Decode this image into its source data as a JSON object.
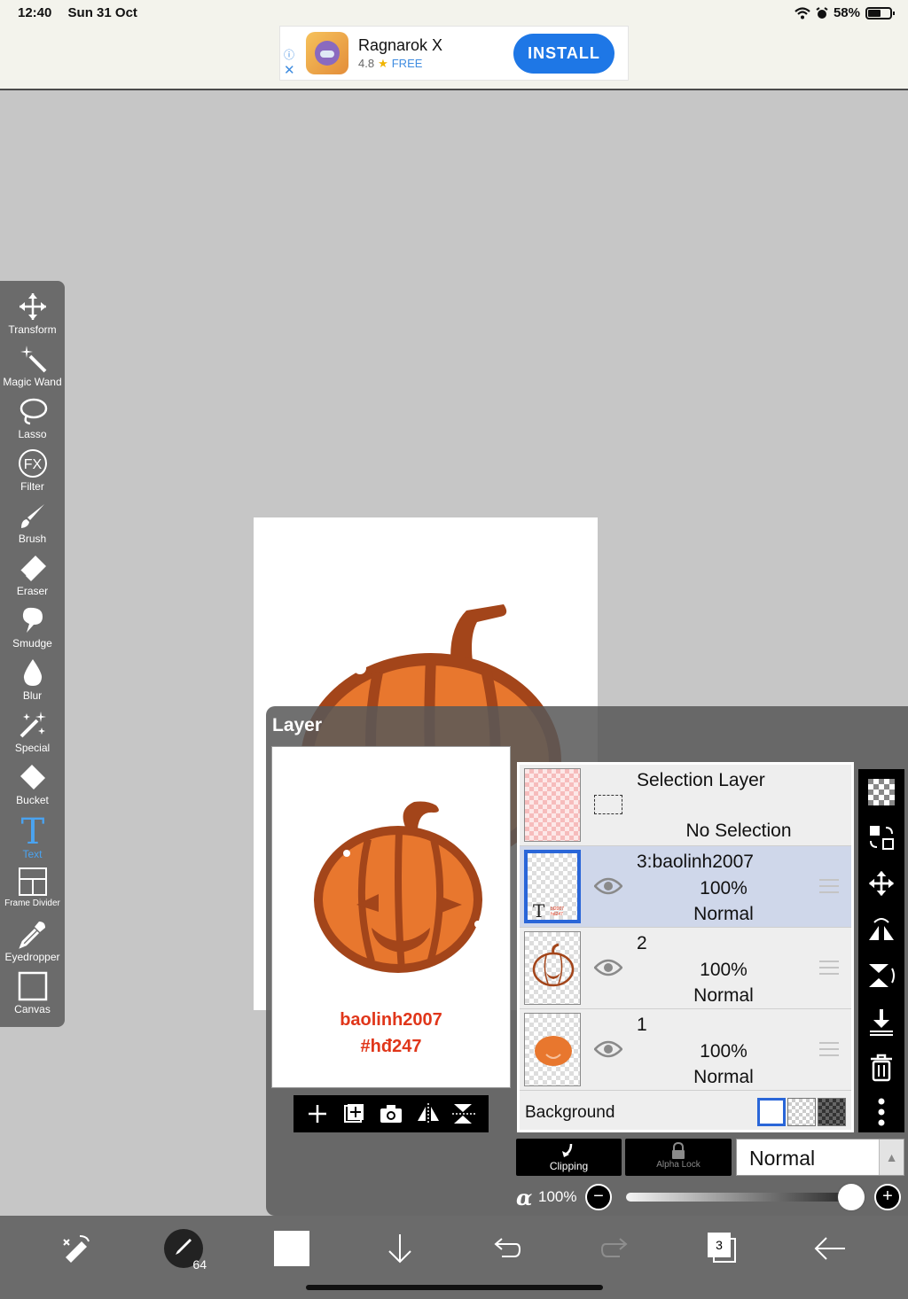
{
  "status": {
    "time": "12:40",
    "date": "Sun 31 Oct",
    "battery": "58%",
    "battery_level": 0.58
  },
  "ad": {
    "title": "Ragnarok X",
    "rating": "4.8",
    "price": "FREE",
    "install": "INSTALL"
  },
  "toolbar": {
    "items": [
      {
        "label": "Transform",
        "icon": "move-icon"
      },
      {
        "label": "Magic Wand",
        "icon": "magic-wand-icon"
      },
      {
        "label": "Lasso",
        "icon": "lasso-icon"
      },
      {
        "label": "Filter",
        "icon": "fx-icon"
      },
      {
        "label": "Brush",
        "icon": "brush-icon"
      },
      {
        "label": "Eraser",
        "icon": "eraser-icon"
      },
      {
        "label": "Smudge",
        "icon": "smudge-icon"
      },
      {
        "label": "Blur",
        "icon": "droplet-icon"
      },
      {
        "label": "Special",
        "icon": "sparkle-icon"
      },
      {
        "label": "Bucket",
        "icon": "bucket-icon"
      },
      {
        "label": "Text",
        "icon": "text-icon",
        "active": true
      },
      {
        "label": "Frame Divider",
        "icon": "frame-divider-icon"
      },
      {
        "label": "Eyedropper",
        "icon": "eyedropper-icon"
      },
      {
        "label": "Canvas",
        "icon": "canvas-icon"
      }
    ]
  },
  "layer_panel": {
    "title": "Layer",
    "watermark": [
      "baolinh2007",
      "#hđ247"
    ],
    "selection_layer": {
      "name": "Selection Layer",
      "status": "No Selection"
    },
    "layers": [
      {
        "name": "3:baolinh2007",
        "opacity": "100%",
        "mode": "Normal",
        "selected": true
      },
      {
        "name": "2",
        "opacity": "100%",
        "mode": "Normal"
      },
      {
        "name": "1",
        "opacity": "100%",
        "mode": "Normal"
      }
    ],
    "background_label": "Background",
    "clipping_label": "Clipping",
    "alpha_lock_label": "Alpha Lock",
    "blend_mode": "Normal",
    "alpha_symbol": "α",
    "opacity": "100%",
    "opacity_level": 1.0
  },
  "bottombar": {
    "brush_size": "64",
    "layer_count": "3"
  },
  "colors": {
    "accent": "#2a66d8",
    "text_tool": "#4aa3f0",
    "watermark": "#e0361a",
    "pumpkin": "#e8772e",
    "pumpkin_outline": "#a3451a"
  }
}
